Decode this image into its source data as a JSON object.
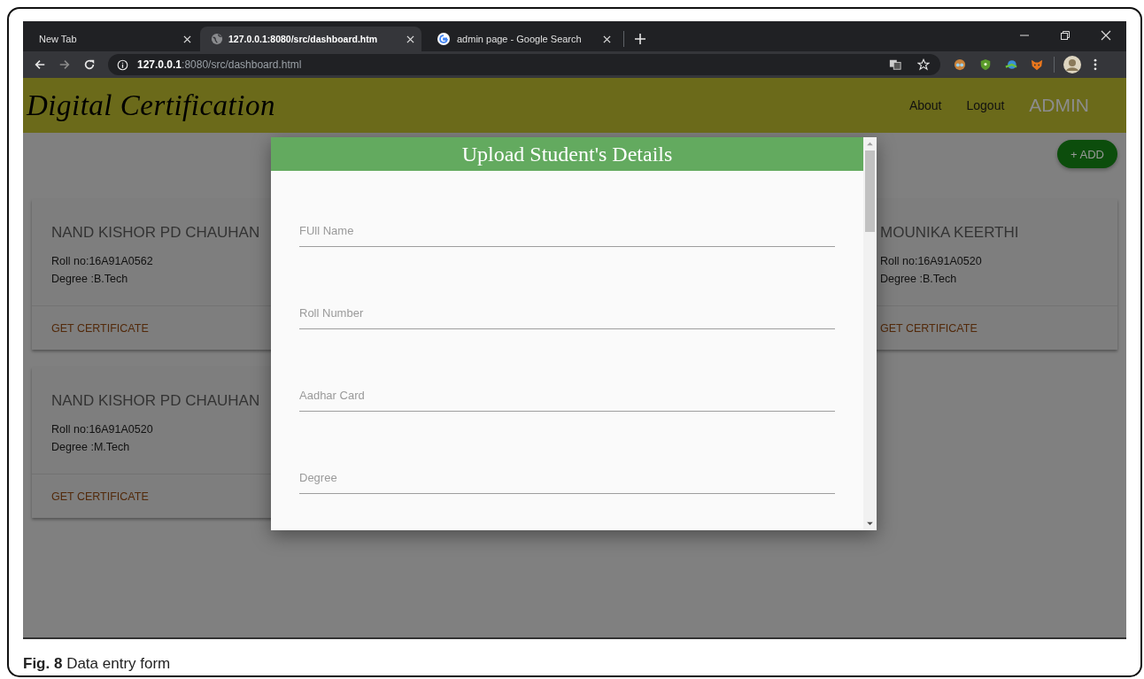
{
  "browser": {
    "tabs": [
      {
        "title": "New Tab",
        "kind": "blank",
        "selected": false
      },
      {
        "title": "127.0.0.1:8080/src/dashboard.htm",
        "kind": "page",
        "selected": true
      },
      {
        "title": "admin page - Google Search",
        "kind": "search",
        "selected": false
      }
    ],
    "address": {
      "host": "127.0.0.1",
      "path": ":8080/src/dashboard.html"
    }
  },
  "header": {
    "brand": "Digital Certification",
    "nav": [
      "About",
      "Logout"
    ],
    "user": "ADMIN"
  },
  "add_button": "+ ADD",
  "card_columns": [
    [
      {
        "name": "NAND KISHOR PD CHAUHAN",
        "roll": "Roll no:16A91A0562",
        "degree": "Degree :B.Tech",
        "action": "GET CERTIFICATE"
      },
      {
        "name": "NAND KISHOR PD CHAUHAN",
        "roll": "Roll no:16A91A0520",
        "degree": "Degree :M.Tech",
        "action": "GET CERTIFICATE"
      }
    ],
    [
      {
        "name": "MOUNIKA KEERTHI",
        "roll": "Roll no:16A91A0520",
        "degree": "Degree :B.Tech",
        "action": "GET CERTIFICATE"
      }
    ]
  ],
  "modal": {
    "title": "Upload Student's Details",
    "fields": [
      {
        "placeholder": "FUll Name"
      },
      {
        "placeholder": "Roll Number"
      },
      {
        "placeholder": "Aadhar Card"
      },
      {
        "placeholder": "Degree"
      }
    ]
  },
  "caption": "**Fig. 8** Data entry form"
}
